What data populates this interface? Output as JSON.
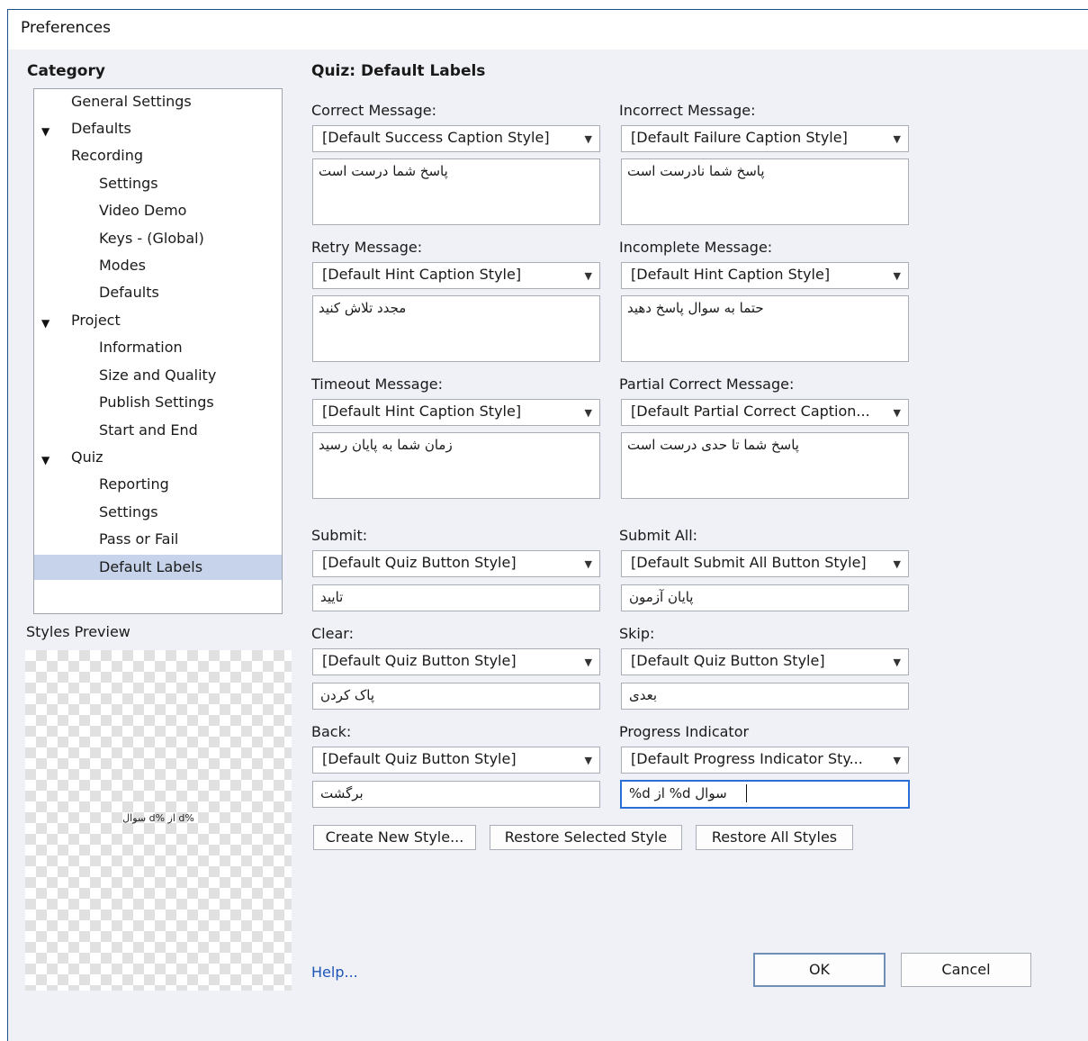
{
  "window": {
    "title": "Preferences"
  },
  "category": {
    "heading": "Category",
    "items": [
      {
        "label": "General Settings"
      },
      {
        "label": "Defaults"
      },
      {
        "label": "Recording"
      },
      {
        "label": "Settings"
      },
      {
        "label": "Video Demo"
      },
      {
        "label": "Keys - (Global)"
      },
      {
        "label": "Modes"
      },
      {
        "label": "Defaults"
      },
      {
        "label": "Project"
      },
      {
        "label": "Information"
      },
      {
        "label": "Size and Quality"
      },
      {
        "label": "Publish Settings"
      },
      {
        "label": "Start and End"
      },
      {
        "label": "Quiz"
      },
      {
        "label": "Reporting"
      },
      {
        "label": "Settings"
      },
      {
        "label": "Pass or Fail"
      },
      {
        "label": "Default Labels"
      }
    ],
    "selected": "Default Labels"
  },
  "preview": {
    "heading": "Styles Preview",
    "text": "%d از %d سوال"
  },
  "main": {
    "heading": "Quiz: Default Labels",
    "messages": [
      {
        "label": "Correct Message:",
        "style": "[Default Success Caption Style]",
        "text": "پاسخ شما درست است"
      },
      {
        "label": "Incorrect Message:",
        "style": "[Default Failure Caption Style]",
        "text": "پاسخ شما نادرست است"
      },
      {
        "label": "Retry Message:",
        "style": "[Default Hint Caption Style]",
        "text": "مجدد تلاش کنید"
      },
      {
        "label": "Incomplete Message:",
        "style": "[Default Hint Caption Style]",
        "text": "حتما به سوال پاسخ دهید"
      },
      {
        "label": "Timeout Message:",
        "style": "[Default Hint Caption Style]",
        "text": "زمان شما به پایان رسید"
      },
      {
        "label": "Partial Correct Message:",
        "style": "[Default Partial Correct Caption...",
        "text": "پاسخ شما تا حدی درست است"
      }
    ],
    "buttons": [
      {
        "label": "Submit:",
        "style": "[Default Quiz Button Style]",
        "text": "تایید"
      },
      {
        "label": "Submit All:",
        "style": "[Default Submit All Button Style]",
        "text": "پایان آزمون"
      },
      {
        "label": "Clear:",
        "style": "[Default Quiz Button Style]",
        "text": "پاک کردن"
      },
      {
        "label": "Skip:",
        "style": "[Default Quiz Button Style]",
        "text": "بعدی"
      },
      {
        "label": "Back:",
        "style": "[Default Quiz Button Style]",
        "text": "برگشت"
      },
      {
        "label": "Progress Indicator",
        "style": "[Default Progress Indicator Sty...",
        "text": "%d از %d سوال"
      }
    ],
    "actions": {
      "create": "Create New Style...",
      "restore_selected": "Restore Selected Style",
      "restore_all": "Restore All Styles"
    }
  },
  "footer": {
    "help": "Help...",
    "ok": "OK",
    "cancel": "Cancel"
  }
}
